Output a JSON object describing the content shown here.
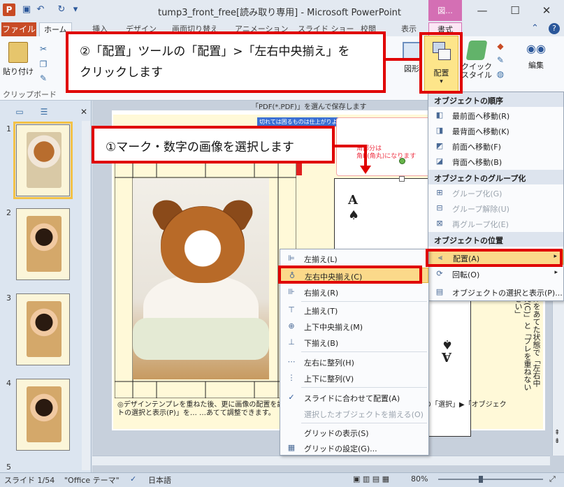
{
  "window": {
    "title": "tump3_front_free[読み取り専用] - Microsoft PowerPoint",
    "context_tab_head": "図...",
    "app_icon": "P",
    "controls": {
      "minimize": "—",
      "maximize": "☐",
      "close": "✕"
    }
  },
  "ribbon": {
    "file_tab": "ファイル",
    "tabs": [
      "ホーム",
      "挿入",
      "デザイン",
      "画面切り替え",
      "アニメーション",
      "スライド ショー",
      "校閲",
      "表示",
      "書式"
    ],
    "paste_label": "貼り付け",
    "clipboard_group": "クリップボード",
    "shape_label": "図形",
    "arrange_label": "配置",
    "quickstyle_label": "クイック\nスタイル",
    "edit_label": "編集"
  },
  "callouts": {
    "step2_line1": "②「配置」ツールの「配置」>「左右中央揃え」を",
    "step2_line2": "クリックします",
    "step1": "①マーク・数字の画像を選択します"
  },
  "arrange_menu": {
    "order_header": "オブジェクトの順序",
    "order_items": [
      "最前面へ移動(R)",
      "最背面へ移動(K)",
      "前面へ移動(F)",
      "背面へ移動(B)"
    ],
    "group_header": "オブジェクトのグループ化",
    "group_items": [
      "グループ化(G)",
      "グループ解除(U)",
      "再グループ化(E)"
    ],
    "position_header": "オブジェクトの位置",
    "position_items": [
      "配置(A)",
      "回転(O)",
      "オブジェクトの選択と表示(P)..."
    ]
  },
  "align_menu": {
    "items": [
      "左揃え(L)",
      "左右中央揃え(C)",
      "右揃え(R)",
      "上揃え(T)",
      "上下中央揃え(M)",
      "下揃え(B)",
      "左右に整列(H)",
      "上下に整列(V)",
      "スライドに合わせて配置(A)",
      "選択したオブジェクトを揃える(O)",
      "グリッドの表示(S)",
      "グリッドの設定(G)..."
    ]
  },
  "slide": {
    "top_note": "「PDF(*.PDF)」を選んで保存します",
    "blue_label": "切れては困るものは仕上がりより",
    "pink_note_line1": "角R(角丸)になります",
    "pink_note_line0": "角部分は",
    "card_rank": "A",
    "card_suit": "♠",
    "right_note": "ツールをあてた状態で「左右中央揃え(C)」と「プレを重ねないください」",
    "bottom_note": "◎デザインテンプレを重ねた後、更に画像の配置を調整する場合は「ホーム」タブ ▶「編集」タブの「選択」▶「オブジェクトの選択と表示(P)」を…                                  …あてて調整できます。"
  },
  "thumbnails": {
    "numbers": [
      "1",
      "2",
      "3",
      "4",
      "5"
    ]
  },
  "status": {
    "slide": "スライド 1/54",
    "theme": "\"Office テーマ\"",
    "language": "日本語",
    "zoom": "80%"
  }
}
